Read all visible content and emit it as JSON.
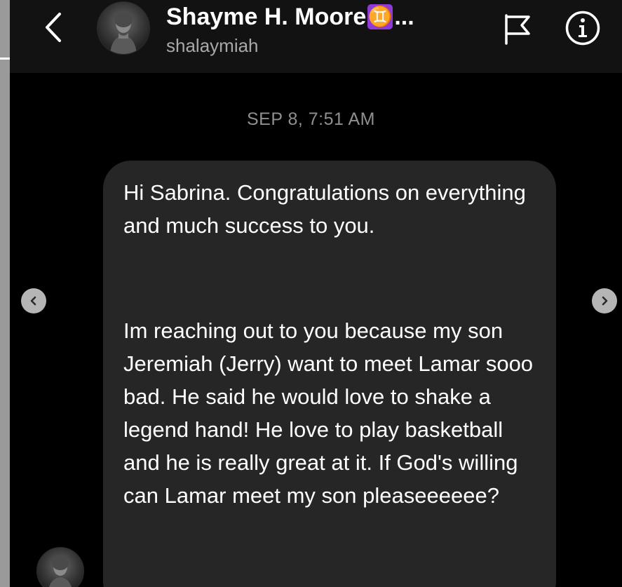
{
  "header": {
    "display_name": "Shayme H. Moore",
    "name_emoji": "♊",
    "ellipsis": "...",
    "username": "shalaymiah",
    "back_icon": "chevron-left-icon",
    "flag_icon": "flag-icon",
    "info_icon": "info-icon"
  },
  "conversation": {
    "timestamp": "SEP 8, 7:51 AM",
    "messages": [
      {
        "paragraph_1": "Hi Sabrina. Congratulations on everything and much success to you.",
        "paragraph_2": "Im reaching out to you because my son Jeremiah (Jerry) want to meet Lamar sooo bad. He said he would love to shake a legend hand! He love to play basketball and he is really great at it. If God's willing can Lamar meet my son pleaseeeeee?"
      }
    ]
  },
  "gallery_nav": {
    "prev_icon": "chevron-left-icon",
    "next_icon": "chevron-right-icon"
  },
  "colors": {
    "background": "#000000",
    "header": "#121212",
    "bubble": "#262626",
    "timestamp": "#8f8f8f",
    "username": "#a8a8a8",
    "emoji_badge": "#8e3bd6"
  }
}
